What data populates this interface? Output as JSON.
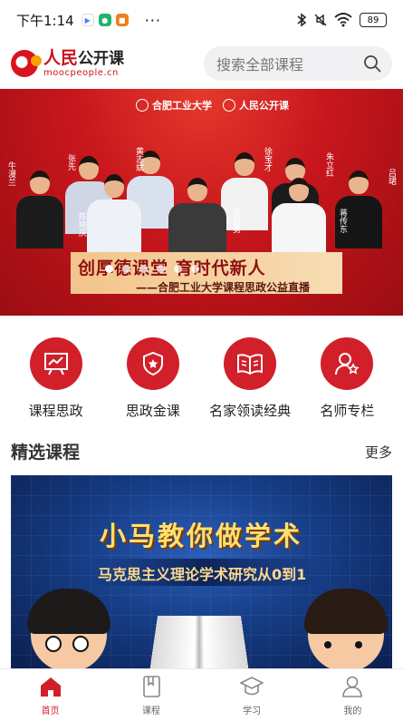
{
  "status_bar": {
    "time": "下午1:14",
    "apps": [
      {
        "icon": "play-store-icon",
        "glyph": "▶",
        "color": "#ffffff"
      },
      {
        "icon": "chat-app-icon",
        "glyph": "●",
        "color": "#22b36b"
      },
      {
        "icon": "orange-app-icon",
        "glyph": "■",
        "color": "#f07e1a"
      }
    ],
    "more": "···",
    "battery": "89"
  },
  "header": {
    "logo_main": "人民",
    "logo_sub": "公开课",
    "logo_url": "moocpeople.cn",
    "search_placeholder": "搜索全部课程"
  },
  "banner": {
    "logo_left": "合肥工业大学",
    "logo_right": "人民公开课",
    "title": "创厚德课堂 育时代新人",
    "subtitle": "——合肥工业大学课程思政公益直播",
    "names": [
      "牛漫兰",
      "张先",
      "黄志斌",
      "徐宝才",
      "朱立红",
      "吕珺",
      "陈晓庆",
      "梁昌勇",
      "蒋传东"
    ],
    "dots": 6,
    "active_dot": 0
  },
  "categories": [
    {
      "label": "课程思政",
      "icon": "presentation-board-icon"
    },
    {
      "label": "思政金课",
      "icon": "badge-shield-icon"
    },
    {
      "label": "名家领读经典",
      "icon": "open-book-icon"
    },
    {
      "label": "名师专栏",
      "icon": "teacher-star-icon"
    }
  ],
  "featured": {
    "title": "精选课程",
    "more_label": "更多",
    "course": {
      "title": "小马教你做学术",
      "subtitle": "马克思主义理论学术研究从0到1"
    }
  },
  "bottom_nav": [
    {
      "label": "首页",
      "icon": "home-icon",
      "active": true
    },
    {
      "label": "课程",
      "icon": "book-icon",
      "active": false
    },
    {
      "label": "学习",
      "icon": "graduation-cap-icon",
      "active": false
    },
    {
      "label": "我的",
      "icon": "user-icon",
      "active": false
    }
  ],
  "colors": {
    "brand_red": "#d1202a",
    "banner_red": "#c8161d",
    "course_blue": "#163d86"
  }
}
